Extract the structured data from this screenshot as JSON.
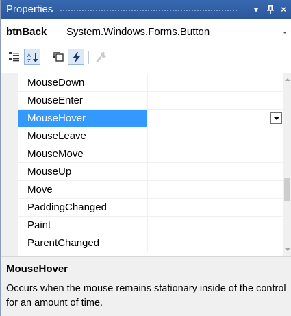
{
  "window": {
    "title": "Properties",
    "buttons": {
      "dropdown": "▾",
      "pin": "ᵻ",
      "close": "×"
    }
  },
  "object_selector": {
    "name": "btnBack",
    "type": "System.Windows.Forms.Button"
  },
  "toolbar": {
    "buttons": [
      {
        "icon": "categorized-icon",
        "checked": false
      },
      {
        "icon": "alphabetical-sort-icon",
        "checked": true
      },
      {
        "icon": "properties-icon",
        "checked": false
      },
      {
        "icon": "events-lightning-icon",
        "checked": true
      },
      {
        "icon": "property-pages-wrench-icon",
        "checked": false,
        "disabled": true
      }
    ]
  },
  "events": [
    {
      "name": "MouseDown",
      "value": ""
    },
    {
      "name": "MouseEnter",
      "value": ""
    },
    {
      "name": "MouseHover",
      "value": "",
      "selected": true
    },
    {
      "name": "MouseLeave",
      "value": ""
    },
    {
      "name": "MouseMove",
      "value": ""
    },
    {
      "name": "MouseUp",
      "value": ""
    },
    {
      "name": "Move",
      "value": ""
    },
    {
      "name": "PaddingChanged",
      "value": ""
    },
    {
      "name": "Paint",
      "value": ""
    },
    {
      "name": "ParentChanged",
      "value": ""
    }
  ],
  "description": {
    "title": "MouseHover",
    "text": "Occurs when the mouse remains stationary inside of the control for an amount of time."
  },
  "colors": {
    "title_bar": "#2e5ea7",
    "selection": "#3399ff",
    "gutter": "#f0f0f0"
  }
}
